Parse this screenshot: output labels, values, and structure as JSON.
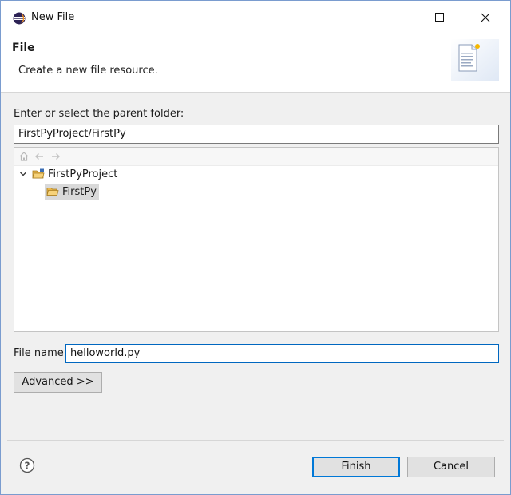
{
  "window": {
    "title": "New File"
  },
  "banner": {
    "title": "File",
    "description": "Create a new file resource."
  },
  "parent": {
    "label": "Enter or select the parent folder:",
    "value": "FirstPyProject/FirstPy"
  },
  "tree": {
    "items": [
      {
        "label": "FirstPyProject",
        "expanded": true
      },
      {
        "label": "FirstPy",
        "selected": true
      }
    ]
  },
  "filename": {
    "label": "File name:",
    "value": "helloworld.py"
  },
  "buttons": {
    "advanced": "Advanced >>",
    "finish": "Finish",
    "cancel": "Cancel"
  },
  "colors": {
    "accent": "#0078d7",
    "selection": "#d9d9d9",
    "folder": "#e8b64c"
  }
}
